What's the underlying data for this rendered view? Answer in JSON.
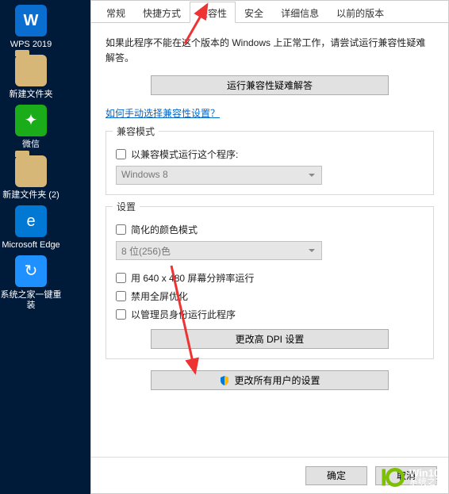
{
  "desktop": {
    "items": [
      {
        "label": "WPS 2019",
        "kind": "wps",
        "glyph": "W"
      },
      {
        "label": "新建文件夹",
        "kind": "folder",
        "glyph": ""
      },
      {
        "label": "微信",
        "kind": "wechat",
        "glyph": "✦"
      },
      {
        "label": "新建文件夹 (2)",
        "kind": "folder",
        "glyph": ""
      },
      {
        "label": "Microsoft Edge",
        "kind": "edge",
        "glyph": "e"
      },
      {
        "label": "系统之家一键重装",
        "kind": "sys",
        "glyph": "↻"
      }
    ]
  },
  "tabs": {
    "items": [
      {
        "label": "常规"
      },
      {
        "label": "快捷方式"
      },
      {
        "label": "兼容性",
        "active": true
      },
      {
        "label": "安全"
      },
      {
        "label": "详细信息"
      },
      {
        "label": "以前的版本"
      }
    ]
  },
  "hint": "如果此程序不能在这个版本的 Windows 上正常工作，请尝试运行兼容性疑难解答。",
  "trouble_btn": "运行兼容性疑难解答",
  "manual_link": "如何手动选择兼容性设置？",
  "compat_mode": {
    "title": "兼容模式",
    "check_label": "以兼容模式运行这个程序:",
    "selected": "Windows 8"
  },
  "settings": {
    "title": "设置",
    "reduced_color": "简化的颜色模式",
    "color_selected": "8 位(256)色",
    "lowres": "用 640 x 480 屏幕分辨率运行",
    "disable_fs": "禁用全屏优化",
    "admin": "以管理员身份运行此程序",
    "dpi_btn": "更改高 DPI 设置"
  },
  "all_users_btn": "更改所有用户的设置",
  "footer": {
    "ok": "确定",
    "cancel": "取消"
  },
  "brand": {
    "line1": "Win10",
    "line2": "系统之家"
  }
}
